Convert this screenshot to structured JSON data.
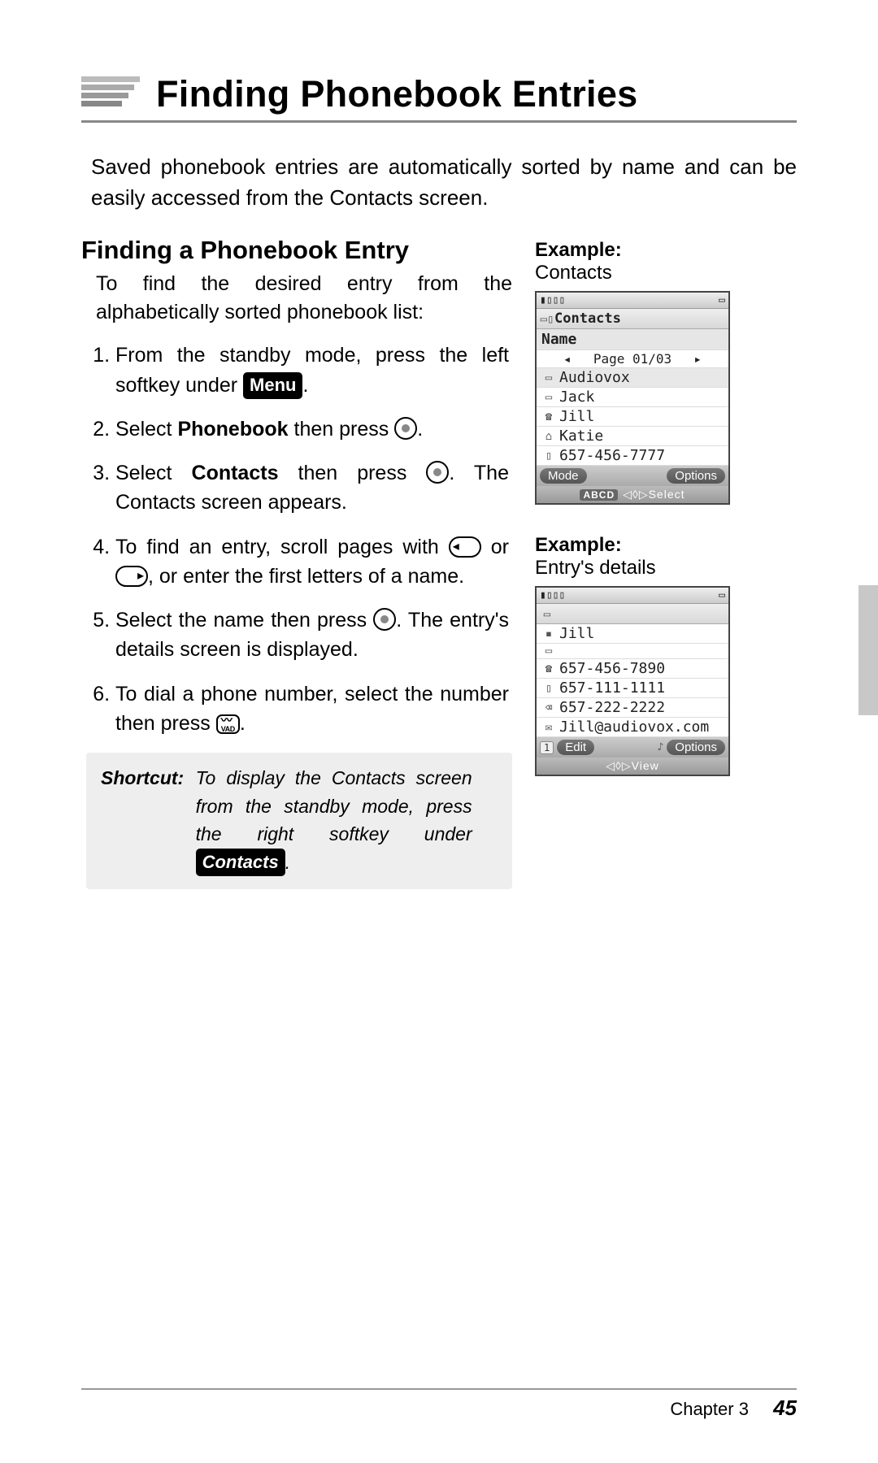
{
  "header": {
    "title": "Finding Phonebook Entries"
  },
  "intro": "Saved phonebook entries are automatically sorted by name and can be easily accessed from the Contacts screen.",
  "section": {
    "heading": "Finding a Phonebook Entry",
    "lead": "To find the desired entry from the alphabetically sorted phonebook list:",
    "steps": {
      "s1a": "From the standby mode, press the left softkey under ",
      "s1_key": "Menu",
      "s1b": ".",
      "s2a": "Select ",
      "s2_bold": "Phonebook",
      "s2b": " then press ",
      "s2c": ".",
      "s3a": "Select ",
      "s3_bold": "Contacts",
      "s3b": " then press ",
      "s3c": ". The Contacts screen appears.",
      "s4a": "To find an entry, scroll pages with ",
      "s4b": " or ",
      "s4c": ", or enter the first letters of a name.",
      "s5a": "Select the name then press ",
      "s5b": ". The entry's details screen is displayed.",
      "s6a": "To dial a phone number, select the number then press ",
      "s6b": "."
    }
  },
  "shortcut": {
    "label": "Shortcut:",
    "body_a": "To display the Contacts screen from the standby mode, press the right softkey under ",
    "key": "Contacts",
    "body_b": "."
  },
  "example1": {
    "label": "Example:",
    "caption": "Contacts",
    "screen": {
      "title": "Contacts",
      "name_hdr": "Name",
      "page": "Page 01/03",
      "rows": [
        "Audiovox",
        "Jack",
        "Jill",
        "Katie",
        "657-456-7777"
      ],
      "soft_left": "Mode",
      "soft_right": "Options",
      "nav_abc": "ABCD",
      "nav_center": "Select"
    }
  },
  "example2": {
    "label": "Example:",
    "caption": "Entry's details",
    "screen": {
      "name": "Jill",
      "lines": [
        "657-456-7890",
        "657-111-1111",
        "657-222-2222",
        "Jill@audiovox.com"
      ],
      "soft_left": "Edit",
      "soft_right": "Options",
      "nav_center": "View"
    }
  },
  "footer": {
    "chapter": "Chapter 3",
    "page": "45"
  },
  "icons": {
    "signal": "▮▯▯▯",
    "battery": "▭",
    "book": "▭",
    "phone": "☎",
    "home": "⌂",
    "mobile": "▯",
    "mail": "✉",
    "fax": "⌫",
    "person": "▪",
    "left_tri": "◂",
    "right_tri": "▸",
    "note": "♪",
    "arrows": "◁▷"
  }
}
